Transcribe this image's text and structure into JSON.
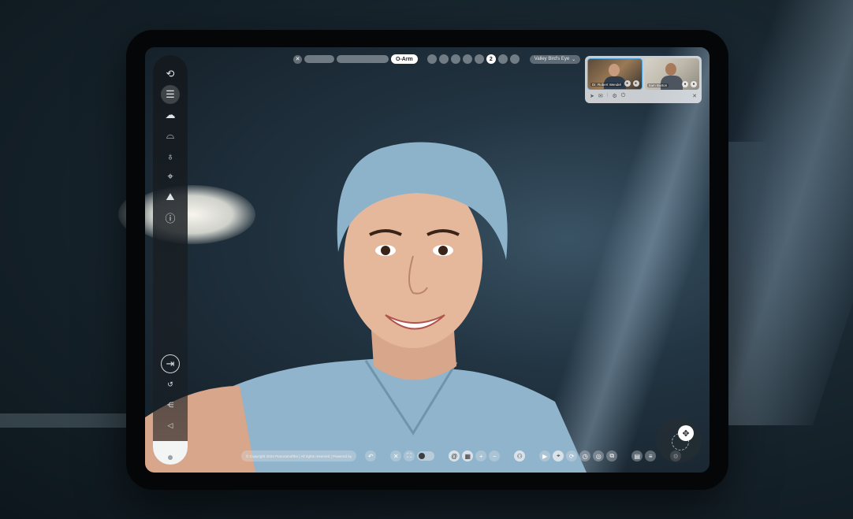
{
  "topbar": {
    "close_icon": "close-icon",
    "active_tab": "O-Arm",
    "selected_step": "2",
    "location_select": "Valley Bird's Eye"
  },
  "sidebar": {
    "items": [
      {
        "icon": "rotate-camera-icon"
      },
      {
        "icon": "layers-icon",
        "active": true
      },
      {
        "icon": "weather-icon"
      },
      {
        "icon": "hat-icon"
      },
      {
        "icon": "stethoscope-icon"
      },
      {
        "icon": "map-pin-icon"
      },
      {
        "icon": "landscape-icon"
      },
      {
        "icon": "info-icon"
      }
    ],
    "bottom_items": [
      {
        "icon": "exit-icon"
      },
      {
        "icon": "history-icon"
      },
      {
        "icon": "share-icon"
      },
      {
        "icon": "mute-icon"
      }
    ]
  },
  "video_call": {
    "participants": [
      {
        "name": "Dr. Robert Wendel"
      },
      {
        "name": "Sam Burton"
      }
    ]
  },
  "bottombar": {
    "copyright": "© Copyright 2024 Panoramofthe | All rights reserved | Powered by"
  },
  "colors": {
    "accent_blue": "#4aa3e0",
    "scrub_blue": "#8fb4cc"
  }
}
